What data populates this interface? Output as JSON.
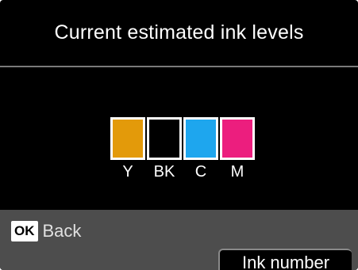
{
  "title": "Current estimated ink levels",
  "cartridges": [
    {
      "label": "Y",
      "color": "#e39a0a",
      "level": 1.0
    },
    {
      "label": "BK",
      "color": "#000000",
      "level": 0.0
    },
    {
      "label": "C",
      "color": "#1ea6ee",
      "level": 1.0
    },
    {
      "label": "M",
      "color": "#ec1e7e",
      "level": 1.0
    }
  ],
  "footer": {
    "ok_key": "OK",
    "back_label": "Back",
    "ink_number_label": "Ink number"
  }
}
